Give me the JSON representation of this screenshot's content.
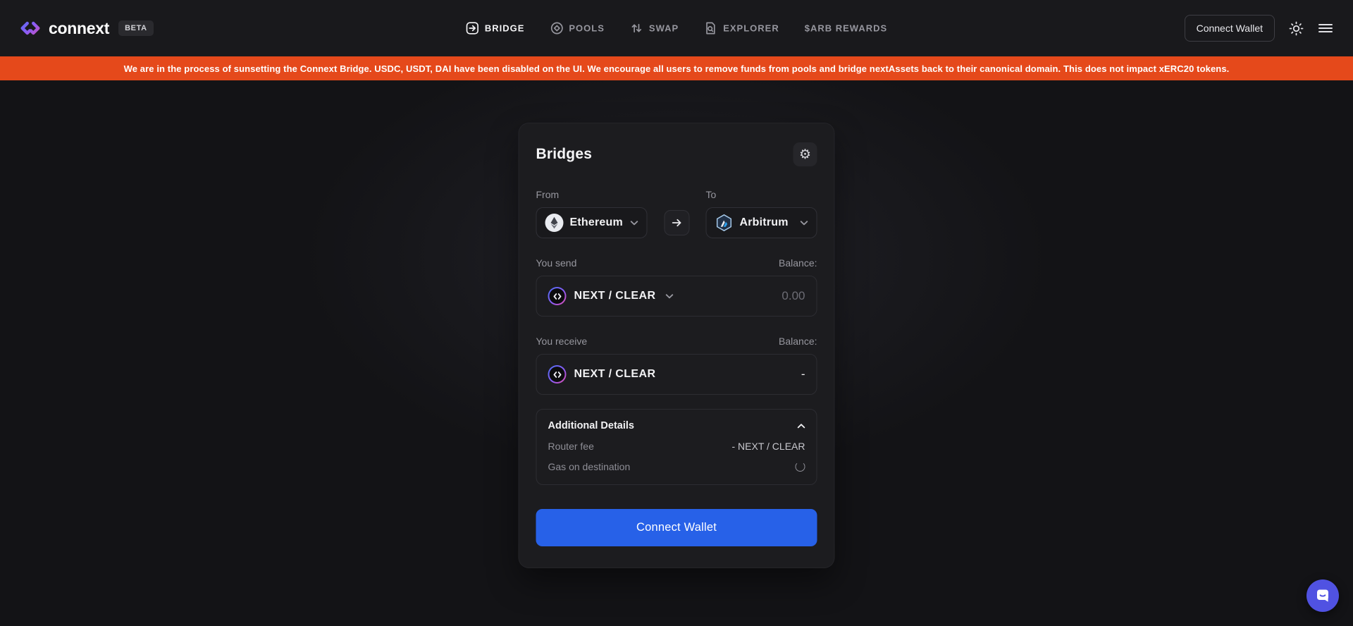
{
  "brand": {
    "name": "connext",
    "badge": "BETA"
  },
  "nav": {
    "items": [
      {
        "label": "BRIDGE",
        "icon": "bridge-icon",
        "active": true
      },
      {
        "label": "POOLS",
        "icon": "pools-icon",
        "active": false
      },
      {
        "label": "SWAP",
        "icon": "swap-icon",
        "active": false
      },
      {
        "label": "EXPLORER",
        "icon": "explorer-icon",
        "active": false
      },
      {
        "label": "$ARB REWARDS",
        "icon": "none",
        "active": false
      }
    ]
  },
  "topbar": {
    "connect_wallet_label": "Connect Wallet",
    "icons": [
      "sun-icon",
      "hamburger-icon"
    ]
  },
  "banner": {
    "text": "We are in the process of sunsetting the Connext Bridge. USDC, USDT, DAI have been disabled on the UI. We encourage all users to remove funds from pools and bridge nextAssets back to their canonical domain. This does not impact xERC20 tokens.",
    "color": "#e5491b"
  },
  "card": {
    "title": "Bridges",
    "settings_icon": "gear-icon",
    "from_label": "From",
    "to_label": "To",
    "from_chain": "Ethereum",
    "to_chain": "Arbitrum",
    "send": {
      "label": "You send",
      "balance_label": "Balance:",
      "token": "NEXT / CLEAR",
      "amount_placeholder": "0.00"
    },
    "receive": {
      "label": "You receive",
      "balance_label": "Balance:",
      "token": "NEXT / CLEAR",
      "value": "-"
    },
    "details": {
      "title": "Additional Details",
      "rows": [
        {
          "label": "Router fee",
          "value": "- NEXT / CLEAR"
        },
        {
          "label": "Gas on destination",
          "value": ""
        }
      ]
    },
    "cta_label": "Connect Wallet"
  },
  "colors": {
    "accent_blue": "#2761e8",
    "banner_orange": "#e5491b",
    "chat_indigo": "#5052e2",
    "card_bg": "#1c1c1f",
    "page_bg": "#131316"
  }
}
